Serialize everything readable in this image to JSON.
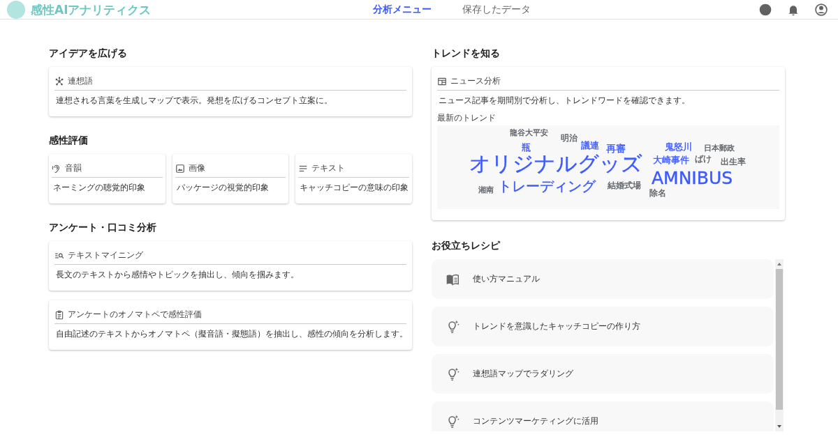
{
  "header": {
    "logo": "感性AIアナリティクス",
    "tabs": [
      {
        "label": "分析メニュー",
        "selected": true
      },
      {
        "label": "保存したデータ",
        "selected": false
      }
    ]
  },
  "left_sections": [
    {
      "title": "アイデアを広げる",
      "cards": [
        {
          "kind": "network",
          "title": "連想語",
          "description": "連想される言葉を生成しマップで表示。発想を広げるコンセプト立案に。"
        }
      ]
    },
    {
      "title": "感性評価",
      "horizontal": true,
      "cards": [
        {
          "kind": "ear",
          "title": "音韻",
          "description": "ネーミングの聴覚的印象"
        },
        {
          "kind": "image",
          "title": "画像",
          "description": "パッケージの視覚的印象"
        },
        {
          "kind": "lines",
          "title": "テキスト",
          "description": "キャッチコピーの意味の印象"
        }
      ]
    },
    {
      "title": "アンケート・口コミ分析",
      "cards": [
        {
          "kind": "search-list",
          "title": "テキストマイニング",
          "description": "長文のテキストから感情やトピックを抽出し、傾向を掴みます。"
        },
        {
          "kind": "clipboard",
          "title": "アンケートのオノマトペで感性評価",
          "description": "自由記述のテキストからオノマトペ（擬音語・擬態語）を抽出し、感性の傾向を分析します。"
        }
      ]
    }
  ],
  "trends": {
    "title": "トレンドを知る",
    "card": {
      "title": "ニュース分析",
      "description": "ニュース記事を期間別で分析し、トレンドワードを確認できます。",
      "subtitle": "最新のトレンド",
      "words": [
        {
          "text": "龍谷大平安",
          "color": "#5f6368"
        },
        {
          "text": "明治",
          "color": "#5f6368"
        },
        {
          "text": "瓶",
          "color": "#3d5afe"
        },
        {
          "text": "議連",
          "color": "#3d5afe"
        },
        {
          "text": "再審",
          "color": "#3d5afe"
        },
        {
          "text": "鬼怒川",
          "color": "#3d5afe"
        },
        {
          "text": "日本郵政",
          "color": "#5f6368"
        },
        {
          "text": "オリジナルグッズ",
          "color": "#3d5afe"
        },
        {
          "text": "大崎事件",
          "color": "#3d5afe"
        },
        {
          "text": "ばけ",
          "color": "#5f6368"
        },
        {
          "text": "出生率",
          "color": "#5f6368"
        },
        {
          "text": "AMNIBUS",
          "color": "#3d5afe"
        },
        {
          "text": "湘南",
          "color": "#5f6368"
        },
        {
          "text": "トレーディング",
          "color": "#3d5afe"
        },
        {
          "text": "結婚式場",
          "color": "#5f6368"
        },
        {
          "text": "除名",
          "color": "#5f6368"
        }
      ]
    }
  },
  "recipes": {
    "title": "お役立ちレシピ",
    "items": [
      {
        "kind": "book",
        "label": "使い方マニュアル"
      },
      {
        "kind": "bulb",
        "label": "トレンドを意識したキャッチコピーの作り方"
      },
      {
        "kind": "bulb",
        "label": "連想語マップでラダリング"
      },
      {
        "kind": "bulb",
        "label": "コンテンツマーケティングに活用"
      }
    ]
  }
}
